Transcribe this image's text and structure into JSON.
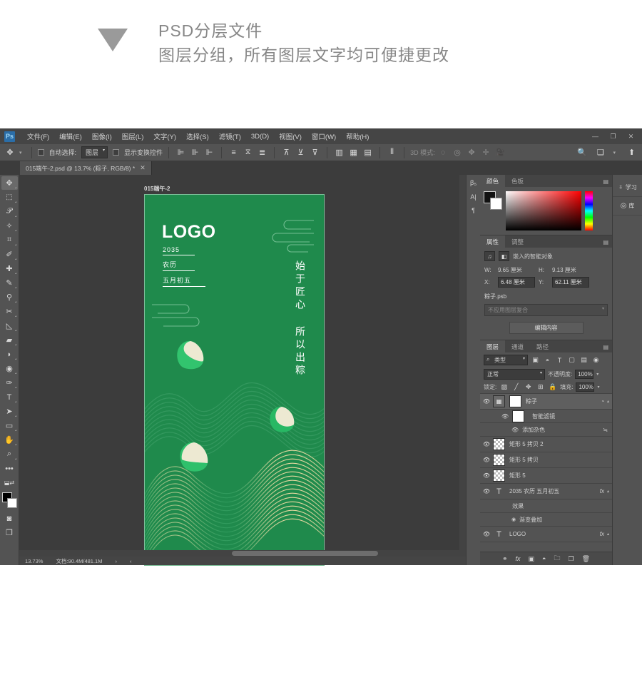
{
  "header": {
    "line1": "PSD分层文件",
    "line2": "图层分组，所有图层文字均可便捷更改",
    "triangle_icon": "triangle-down-icon"
  },
  "photoshop": {
    "logo": "Ps",
    "menu": [
      {
        "label": "文件(F)"
      },
      {
        "label": "编辑(E)"
      },
      {
        "label": "图像(I)"
      },
      {
        "label": "图层(L)"
      },
      {
        "label": "文字(Y)"
      },
      {
        "label": "选择(S)"
      },
      {
        "label": "滤镜(T)"
      },
      {
        "label": "3D(D)"
      },
      {
        "label": "视图(V)"
      },
      {
        "label": "窗口(W)"
      },
      {
        "label": "帮助(H)"
      }
    ],
    "window_buttons": {
      "minimize": "—",
      "maximize": "❐",
      "close": "✕"
    },
    "options_bar": {
      "tool_icon": "move-tool-icon",
      "auto_select_label": "自动选择:",
      "auto_select_value": "图层",
      "show_transform_label": "显示变换控件",
      "mode_3d_label": "3D 模式:",
      "search_icon": "search-icon",
      "workspace_icon": "workspace-icon",
      "share_icon": "share-icon"
    },
    "tab": {
      "title": "015端午-2.psd @ 13.7% (粽子, RGB/8) *",
      "close": "✕"
    },
    "toolbar": [
      {
        "name": "move-tool",
        "glyph": "✥",
        "selected": true
      },
      {
        "name": "marquee-tool",
        "glyph": "▭"
      },
      {
        "name": "lasso-tool",
        "glyph": "✒"
      },
      {
        "name": "quick-selection-tool",
        "glyph": "❧"
      },
      {
        "name": "crop-tool",
        "glyph": "⌗"
      },
      {
        "name": "eyedropper-tool",
        "glyph": "✐"
      },
      {
        "name": "healing-brush-tool",
        "glyph": "✚"
      },
      {
        "name": "brush-tool",
        "glyph": "✎"
      },
      {
        "name": "clone-stamp-tool",
        "glyph": "⚲"
      },
      {
        "name": "history-brush-tool",
        "glyph": "✂"
      },
      {
        "name": "eraser-tool",
        "glyph": "◣"
      },
      {
        "name": "gradient-tool",
        "glyph": "▰"
      },
      {
        "name": "blur-tool",
        "glyph": "💧"
      },
      {
        "name": "dodge-tool",
        "glyph": "◉"
      },
      {
        "name": "pen-tool",
        "glyph": "✑"
      },
      {
        "name": "type-tool",
        "glyph": "T"
      },
      {
        "name": "path-selection-tool",
        "glyph": "➤"
      },
      {
        "name": "shape-tool",
        "glyph": "▭"
      },
      {
        "name": "hand-tool",
        "glyph": "✋"
      },
      {
        "name": "zoom-tool",
        "glyph": "🔍"
      },
      {
        "name": "more-tools",
        "glyph": "•••"
      }
    ],
    "canvas": {
      "document_label": "015端午-2",
      "poster": {
        "background_color": "#1f8a4c",
        "logo_text": "LOGO",
        "meta_lines": [
          "2035",
          "农历",
          "五月初五"
        ],
        "vertical_text": "始于匠心 所以出粽"
      }
    },
    "status_bar": {
      "zoom": "13.73%",
      "doc_info": "文档:90.4M/481.1M",
      "next_arrow": "›",
      "prev_arrow": "‹"
    },
    "panels": {
      "color": {
        "tabs": [
          "颜色",
          "色板"
        ],
        "active_tab": "颜色",
        "menu_icon": "panel-menu-icon"
      },
      "properties": {
        "tabs": [
          "属性",
          "调整"
        ],
        "active_tab": "属性",
        "object_type": "嵌入的智能对象",
        "fields": [
          {
            "label": "W:",
            "value": "9.65 厘米"
          },
          {
            "label": "H:",
            "value": "9.13 厘米"
          },
          {
            "label": "X:",
            "value": "6.48 厘米"
          },
          {
            "label": "Y:",
            "value": "62.11 厘米"
          }
        ],
        "file_name": "粽子.psb",
        "layer_comp": "不应用图层复合",
        "edit_button": "编辑内容"
      },
      "layers": {
        "tabs": [
          "图层",
          "通道",
          "路径"
        ],
        "active_tab": "图层",
        "filter_label": "类型",
        "blend_mode": "正常",
        "opacity_label": "不透明度:",
        "opacity_value": "100%",
        "lock_label": "锁定:",
        "fill_label": "填充:",
        "fill_value": "100%",
        "rows": [
          {
            "name": "粽子",
            "kind": "smart-object",
            "selected": true,
            "eye": true,
            "has_fx": false,
            "caret": true
          },
          {
            "name": "智能滤镜",
            "kind": "sub",
            "eye": true
          },
          {
            "name": "添加杂色",
            "kind": "sub2",
            "eye": true,
            "trailing": "≒"
          },
          {
            "name": "矩形 5 拷贝 2",
            "kind": "shape",
            "eye": true
          },
          {
            "name": "矩形 5 拷贝",
            "kind": "shape",
            "eye": true
          },
          {
            "name": "矩形 5",
            "kind": "shape",
            "eye": true
          },
          {
            "name": "2035 农历 五月初五",
            "kind": "text",
            "eye": true,
            "has_fx": true,
            "caret": true
          },
          {
            "name": "效果",
            "kind": "sub",
            "eye": false
          },
          {
            "name": "渐变叠加",
            "kind": "sub2",
            "eye": true
          },
          {
            "name": "LOGO",
            "kind": "text",
            "eye": true,
            "has_fx": true,
            "caret": true
          }
        ],
        "footer_icons": [
          "link-icon",
          "fx-icon",
          "mask-icon",
          "adjustment-icon",
          "folder-icon",
          "new-layer-icon",
          "delete-icon"
        ]
      },
      "dock": [
        {
          "label": "学习",
          "icon": "lightbulb-icon"
        },
        {
          "label": "库",
          "icon": "libraries-icon"
        }
      ],
      "side_strip": [
        "character-panel-icon",
        "paragraph-panel-icon",
        "glyphs-panel-icon"
      ]
    }
  }
}
